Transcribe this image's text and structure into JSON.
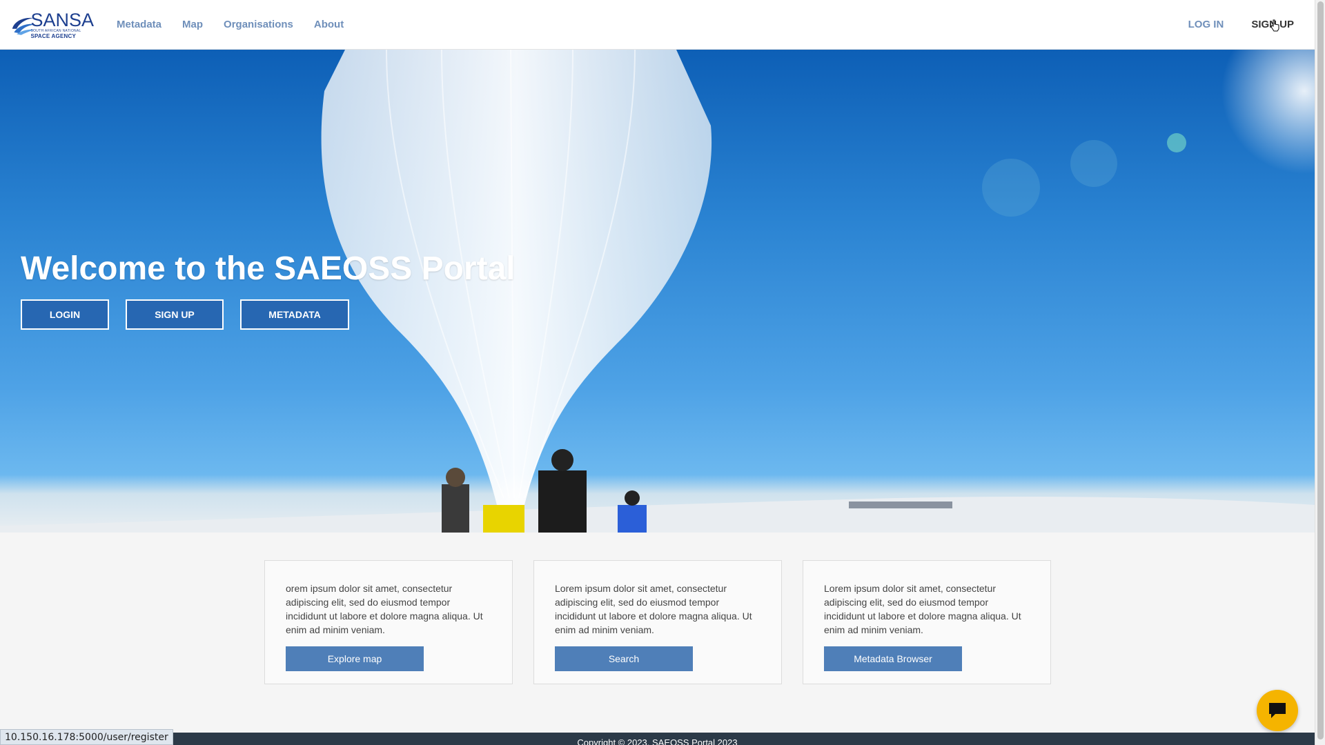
{
  "brand": {
    "name": "SANSA",
    "subtitle": "SOUTH AFRICAN NATIONAL",
    "subtitle2": "SPACE AGENCY",
    "icon": "sansa-logo-icon",
    "color": "#1d3f8f"
  },
  "nav": {
    "links": [
      "Metadata",
      "Map",
      "Organisations",
      "About"
    ],
    "login": "LOG IN",
    "signup": "SIGN UP",
    "link_color": "#6f8fba"
  },
  "hero": {
    "title": "Welcome to the SAEOSS Portal",
    "buttons": [
      "LOGIN",
      "SIGN UP",
      "METADATA"
    ]
  },
  "cards": [
    {
      "text": "orem ipsum dolor sit amet, consectetur adipiscing elit, sed do eiusmod tempor incididunt ut labore et dolore magna aliqua. Ut enim ad minim veniam.",
      "button": "Explore map"
    },
    {
      "text": "Lorem ipsum dolor sit amet, consectetur adipiscing elit, sed do eiusmod tempor incididunt ut labore et dolore magna aliqua. Ut enim ad minim veniam.",
      "button": "Search"
    },
    {
      "text": "Lorem ipsum dolor sit amet, consectetur adipiscing elit, sed do eiusmod tempor incididunt ut labore et dolore magna aliqua. Ut enim ad minim veniam.",
      "button": "Metadata Browser"
    }
  ],
  "footer": {
    "copyright": "Copyright © 2023, SAEOSS Portal 2023"
  },
  "status_bar": {
    "url": "10.150.16.178:5000/user/register"
  },
  "chat": {
    "icon": "chat-bubble-icon",
    "color": "#f5b400"
  },
  "colors": {
    "button_blue": "#4f7fb8",
    "footer_bg": "#2c3a48"
  }
}
